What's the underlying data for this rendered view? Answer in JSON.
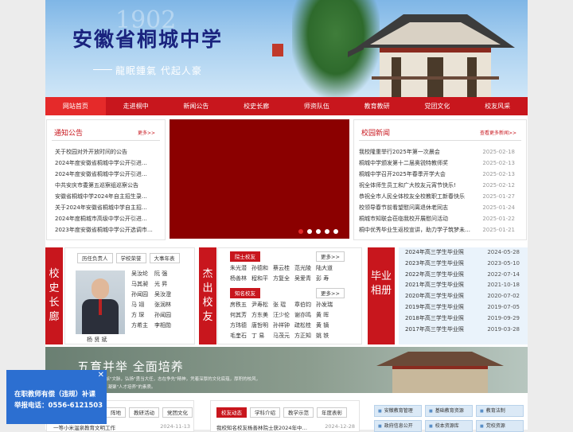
{
  "header": {
    "year_watermark": "1902",
    "title": "安徽省桐城中学",
    "motto": "龍眠鍾氣 代起人豪"
  },
  "nav": [
    "网站首页",
    "走进桐中",
    "新闻公告",
    "校史长廊",
    "师资队伍",
    "教育教研",
    "党团文化",
    "校友风采"
  ],
  "notices": {
    "title": "通知公告",
    "more": "更多>>",
    "items": [
      "关于校园对外开放时间的公告",
      "2024年度安徽省桐城中学公开引进…",
      "2024年度安徽省桐城中学公开引进…",
      "中共安庆市委第五巡察组巡察公告",
      "安徽省桐城中学2024年自主招生录…",
      "关于2024年安徽省桐城中学自主招…",
      "2024年度桐城市高级中学公开引进…",
      "2023年度安徽省桐城中学公开选调市…"
    ]
  },
  "news": {
    "title": "校园新闻",
    "more": "查看更多新闻>>",
    "items": [
      {
        "t": "我校隆重举行2025年第一次晨会",
        "d": "2025-02-18"
      },
      {
        "t": "桐城中学颁发第十二届奥锐特教师奖",
        "d": "2025-02-13"
      },
      {
        "t": "桐城中学召开2025年春季开学大会",
        "d": "2025-02-13"
      },
      {
        "t": "祝全体师生员工和广大校友元宵节快乐!",
        "d": "2025-02-12"
      },
      {
        "t": "恭祝全市人民全体校友全校教职工新春快乐",
        "d": "2025-01-27"
      },
      {
        "t": "校领导春节前看望慰问离退休老同志",
        "d": "2025-01-24"
      },
      {
        "t": "桐城市知联会莅临我校开展慰问活动",
        "d": "2025-01-22"
      },
      {
        "t": "桐中优秀毕业生返校宣讲，助力学子筑梦未…",
        "d": "2025-01-21"
      }
    ]
  },
  "history": {
    "label": "校史长廊",
    "tabs": [
      "历任负责人",
      "学校荣誉",
      "大事年表"
    ],
    "photo_caption": "杨 贤 斌",
    "names": [
      "吴汝纶",
      "阮 强",
      "马其昶",
      "光 昇",
      "孙闻园",
      "吴汝澄",
      "马 翊",
      "张润林",
      "方 琛",
      "孙闻园",
      "方希主",
      "李相勋"
    ]
  },
  "alumni": {
    "label": "杰出校友",
    "tab1": "院士校友",
    "tab2": "知名校友",
    "more": "更多>>",
    "academicians": [
      "朱光潜",
      "孙德和",
      "蔡云桂",
      "范光陵",
      "陆大道",
      "杨善林",
      "程和平",
      "方复全",
      "吴爱青",
      "彭 寿"
    ],
    "famous": [
      "房秩五",
      "尹寿松",
      "张 琨",
      "章伯钧",
      "孙发瑞",
      "何其芳",
      "方东美",
      "汪少伦",
      "谢亦鸣",
      "黄 晖",
      "方玮德",
      "唐哲明",
      "孙祥钟",
      "疏松桂",
      "黄 镝",
      "毛奎石",
      "丁 易",
      "马茂元",
      "方正知",
      "姚 铁"
    ]
  },
  "graduation": {
    "label": "毕业相册",
    "items": [
      {
        "t": "2024年高三学生毕业照",
        "d": "2024-05-28"
      },
      {
        "t": "2023年高三学生毕业照",
        "d": "2023-05-10"
      },
      {
        "t": "2022年高三学生毕业照",
        "d": "2022-07-14"
      },
      {
        "t": "2021年高三学生毕业照",
        "d": "2021-10-18"
      },
      {
        "t": "2020年高三学生毕业照",
        "d": "2020-07-02"
      },
      {
        "t": "2019年高三学生毕业照",
        "d": "2019-07-05"
      },
      {
        "t": "2018年高三学生毕业照",
        "d": "2019-09-29"
      },
      {
        "t": "2017年高三学生毕业照",
        "d": "2019-03-28"
      }
    ]
  },
  "banner": {
    "title": "五育并举 全面培养",
    "line1": "学校传承\"桐城派\"文脉，弘扬\"勇当大任，志在争先\"精神，凭着深厚的文化底蕴，厚积的校风，",
    "line2": "践行立德树人，凝聚\"人才培养\"的素质。"
  },
  "bottom": {
    "left_tabs": [
      "阵地",
      "教研活动",
      "党团文化"
    ],
    "left_row": {
      "t": "一等小米温泉教育文明工作",
      "d": "2024-11-13"
    },
    "mid_tabs": [
      "校友动态",
      "学科介绍",
      "教学示范",
      "年度表彰"
    ],
    "mid_row": {
      "t": "我校知名校友杨善林院士获2024年中…",
      "d": "2024-12-28"
    },
    "resources": [
      "安徽教育管理",
      "基础教育资源",
      "教育法制",
      "政府信息公开",
      "校本资源库",
      "党校资源"
    ]
  },
  "popup": {
    "line1": "在职教师有偿（违规）补课",
    "line2": "举报电话：0556-6121503",
    "close": "✕"
  },
  "colors": {
    "brand_red": "#c8161d",
    "popup_blue": "#2c6fd1"
  }
}
